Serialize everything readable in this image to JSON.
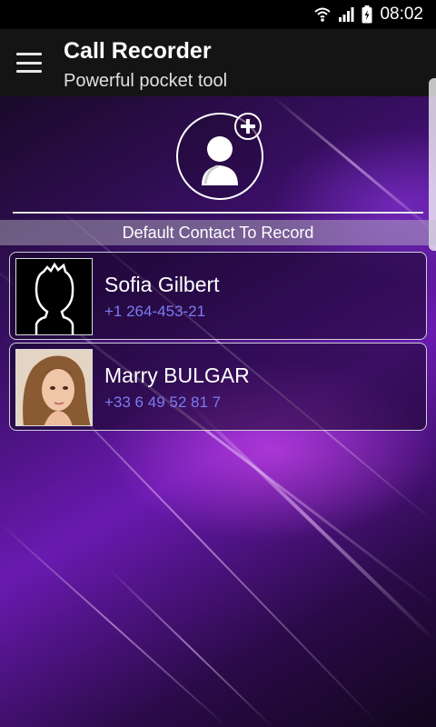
{
  "status_bar": {
    "time": "08:02",
    "icons": [
      "wifi-icon",
      "signal-icon",
      "battery-icon"
    ]
  },
  "app_bar": {
    "menu_icon": "menu-icon",
    "title": "Call Recorder",
    "subtitle": "Powerful pocket tool"
  },
  "add_contact": {
    "icon": "add-contact-icon"
  },
  "section": {
    "label": "Default Contact To Record"
  },
  "contacts": [
    {
      "name": "Sofia Gilbert",
      "phone": "+1 264-453-21",
      "avatar": "default-avatar-icon"
    },
    {
      "name": "Marry BULGAR",
      "phone": "+33 6 49 52 81 7",
      "avatar": "photo-avatar"
    }
  ],
  "colors": {
    "phone_text": "#7a7cf0",
    "app_bar": "#141414",
    "accent_purple": "#6a1ab0"
  }
}
